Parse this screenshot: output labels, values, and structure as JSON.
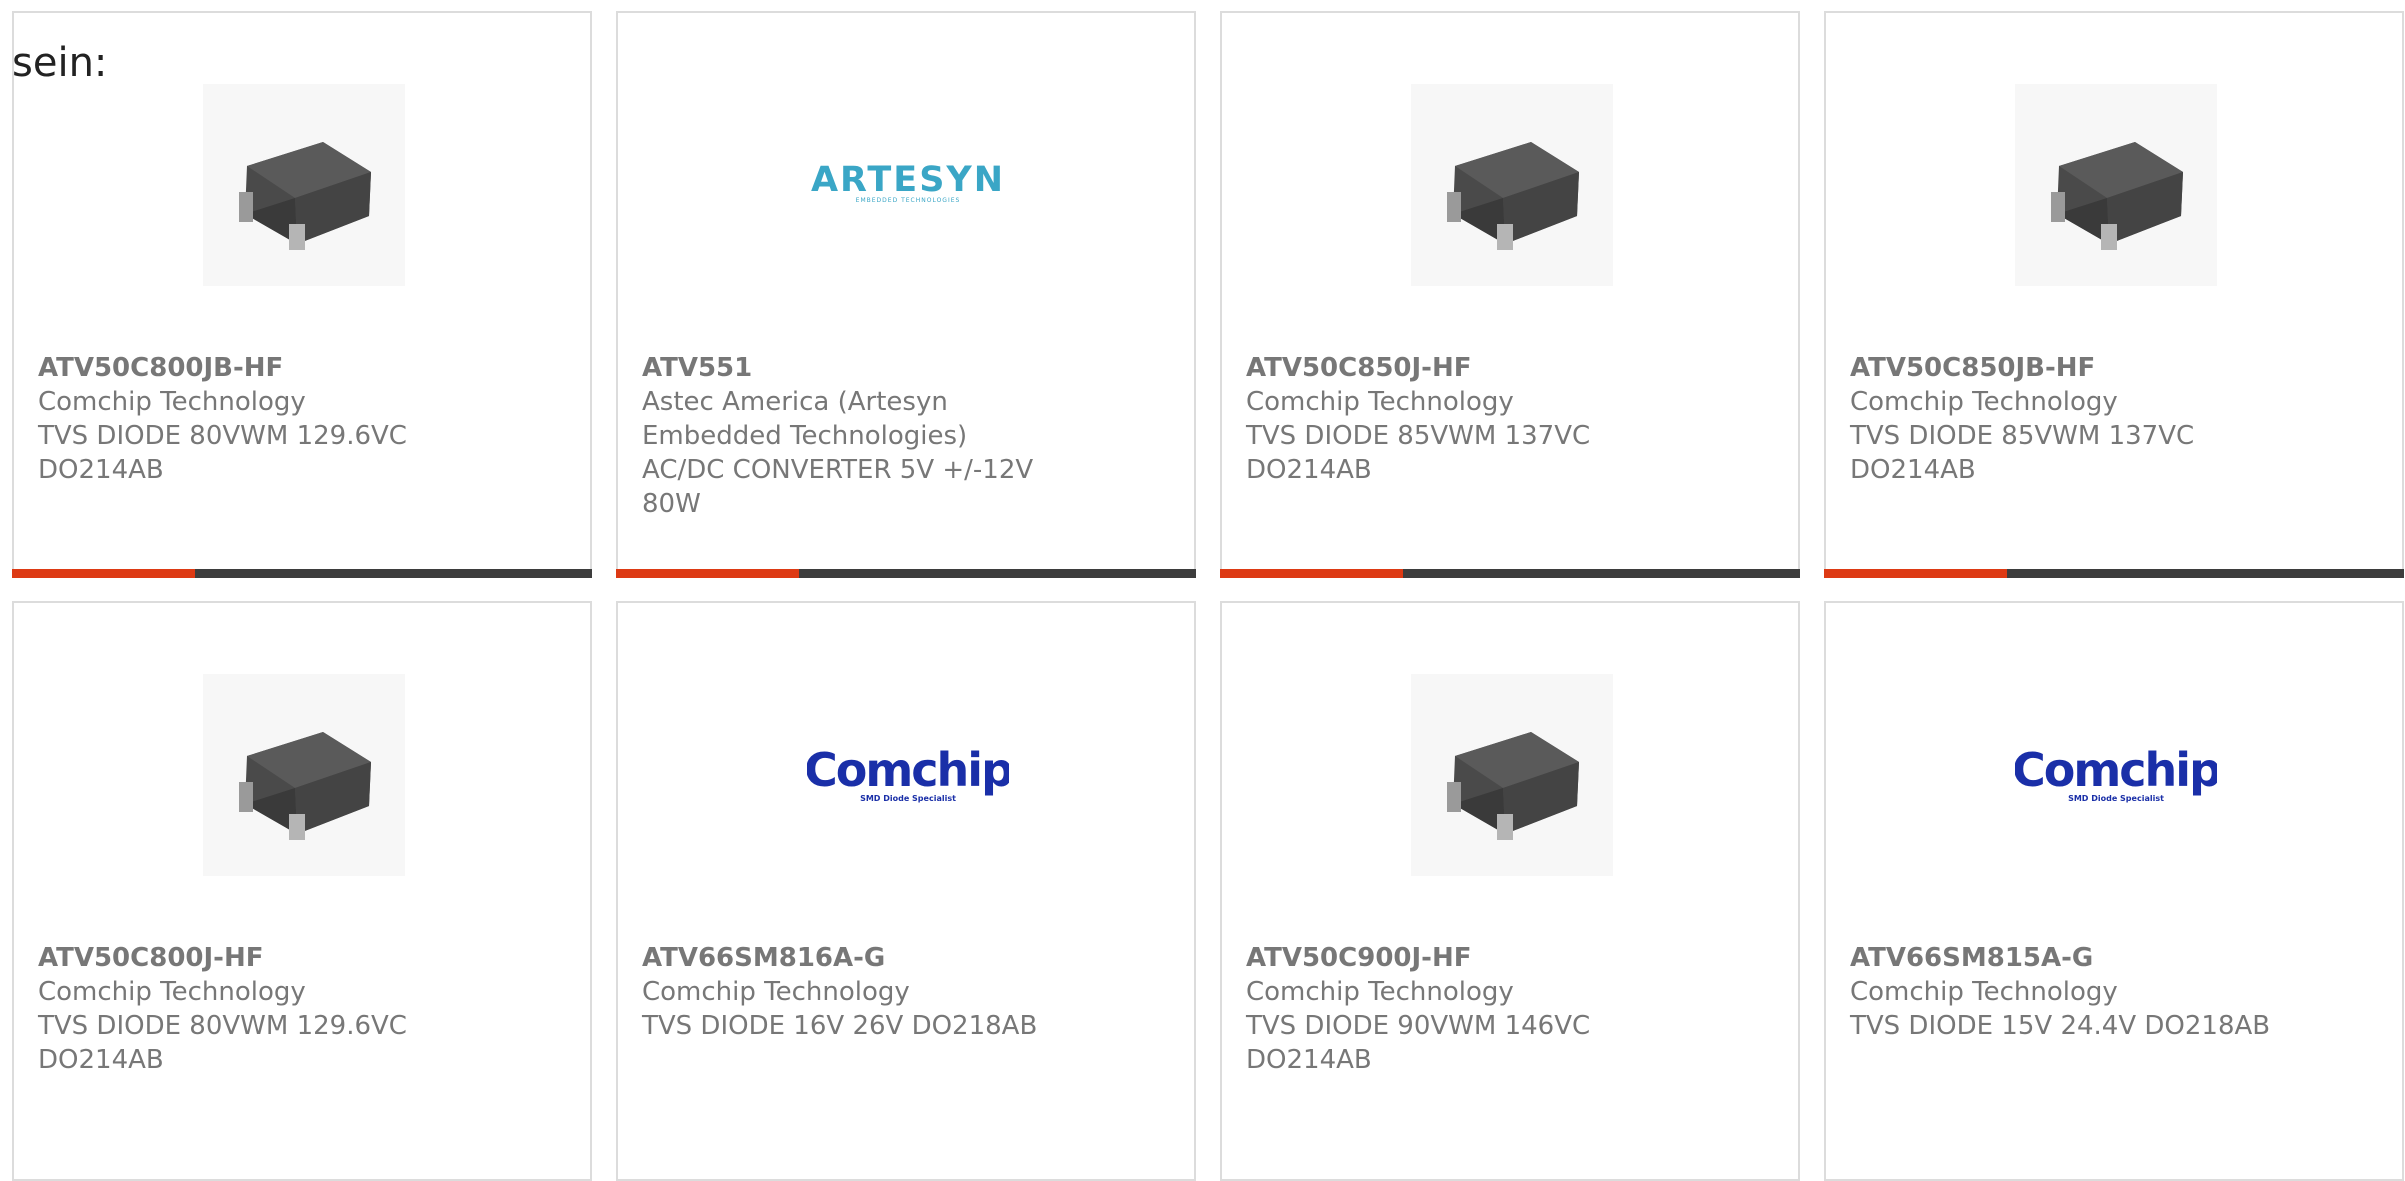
{
  "intro_text": "sein:",
  "colors": {
    "accent_bar": "#dd3a14",
    "dark_bar": "#3d3d3d",
    "card_border": "#dcdcdc",
    "text": "#777777",
    "comchip_blue": "#1a2fa8",
    "artesyn_blue": "#3aa6c6"
  },
  "products": [
    {
      "part_number": "ATV50C800JB-HF",
      "manufacturer": "Comchip Technology",
      "desc1": "TVS DIODE 80VWM 129.6VC",
      "desc2": "DO214AB",
      "desc3": "",
      "image": "diode-package-icon",
      "show_bar": true
    },
    {
      "part_number": "ATV551",
      "manufacturer": "Astec America (Artesyn",
      "desc1": "Embedded Technologies)",
      "desc2": "AC/DC CONVERTER 5V +/-12V",
      "desc3": "80W",
      "image": "artesyn-logo",
      "logo_text": "ARTESYN",
      "logo_sub": "EMBEDDED TECHNOLOGIES",
      "show_bar": true
    },
    {
      "part_number": "ATV50C850J-HF",
      "manufacturer": "Comchip Technology",
      "desc1": "TVS DIODE 85VWM 137VC",
      "desc2": "DO214AB",
      "desc3": "",
      "image": "diode-package-icon",
      "show_bar": true
    },
    {
      "part_number": "ATV50C850JB-HF",
      "manufacturer": "Comchip Technology",
      "desc1": "TVS DIODE 85VWM 137VC",
      "desc2": "DO214AB",
      "desc3": "",
      "image": "diode-package-icon",
      "show_bar": true
    },
    {
      "part_number": "ATV50C800J-HF",
      "manufacturer": "Comchip Technology",
      "desc1": "TVS DIODE 80VWM 129.6VC",
      "desc2": "DO214AB",
      "desc3": "",
      "image": "diode-package-icon",
      "show_bar": false
    },
    {
      "part_number": "ATV66SM816A-G",
      "manufacturer": "Comchip Technology",
      "desc1": "TVS DIODE 16V 26V DO218AB",
      "desc2": "",
      "desc3": "",
      "image": "comchip-logo",
      "logo_text": "Comchip",
      "logo_sub": "SMD Diode Specialist",
      "show_bar": false
    },
    {
      "part_number": "ATV50C900J-HF",
      "manufacturer": "Comchip Technology",
      "desc1": "TVS DIODE 90VWM 146VC",
      "desc2": "DO214AB",
      "desc3": "",
      "image": "diode-package-icon",
      "show_bar": false
    },
    {
      "part_number": "ATV66SM815A-G",
      "manufacturer": "Comchip Technology",
      "desc1": "TVS DIODE 15V 24.4V DO218AB",
      "desc2": "",
      "desc3": "",
      "image": "comchip-logo",
      "logo_text": "Comchip",
      "logo_sub": "SMD Diode Specialist",
      "show_bar": false
    }
  ]
}
